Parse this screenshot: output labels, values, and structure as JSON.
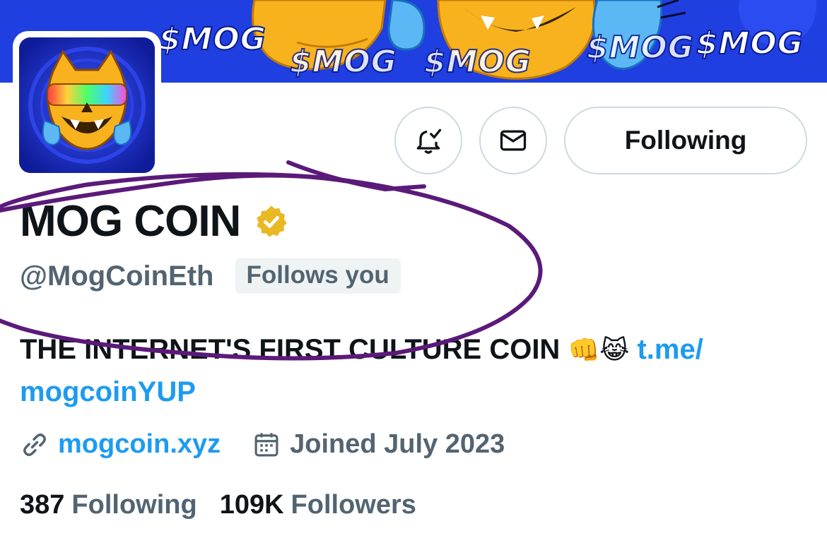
{
  "banner": {
    "texts": [
      "$MOG",
      "$MOG",
      "$MOG",
      "$MOG",
      "$MOG"
    ]
  },
  "actions": {
    "notify_icon": "bell-check-icon",
    "message_icon": "mail-icon",
    "following_label": "Following"
  },
  "profile": {
    "name": "MOG COIN",
    "verified": "verified-badge-gold",
    "handle": "@MogCoinEth",
    "follows_you": "Follows you",
    "bio_text": "THE INTERNET'S FIRST CULTURE COIN",
    "bio_emoji_1": "👊",
    "bio_emoji_2": "😹",
    "bio_link_part1": "t.me/",
    "bio_link_part2": "mogcoinYUP",
    "website": "mogcoin.xyz",
    "joined": "Joined July 2023"
  },
  "stats": {
    "following_count": "387",
    "following_label": "Following",
    "followers_count": "109K",
    "followers_label": "Followers"
  },
  "colors": {
    "accent": "#1d9bf0",
    "banner": "#1f3fe0",
    "verified": "#e8b923",
    "annotation": "#5b1a7a"
  }
}
